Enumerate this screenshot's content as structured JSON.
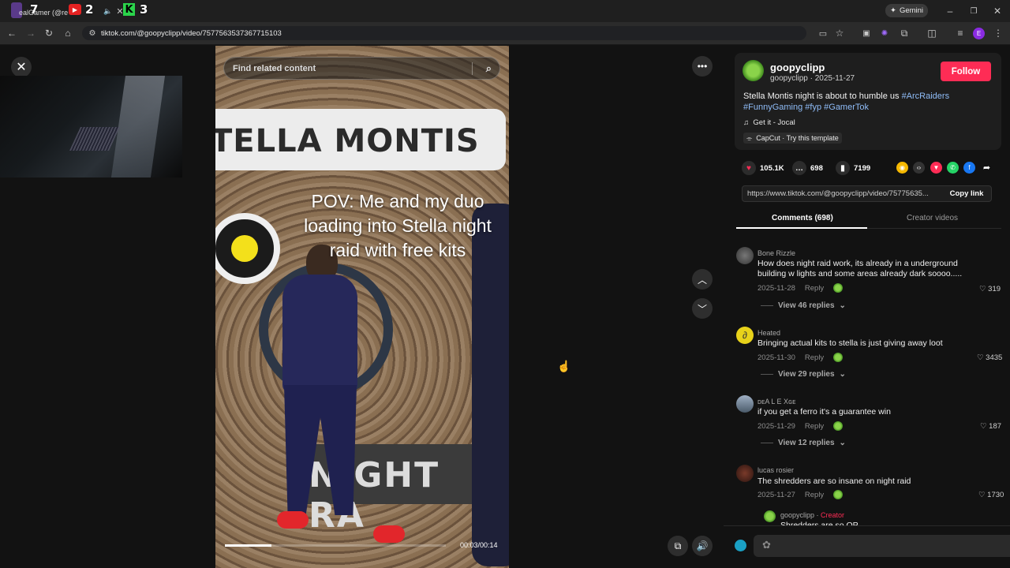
{
  "browser": {
    "overlay_counts": [
      "7",
      "2",
      "3"
    ],
    "tab_title": "ealGamer (@re",
    "gemini_label": "Gemini",
    "url": "tiktok.com/@goopyclipp/video/7577563537367715103"
  },
  "video": {
    "search_placeholder": "Find related content",
    "top_sign": "TELLA MONTIS",
    "bottom_sign": "NIGHT RA",
    "caption": "POV: Me and my duo loading into Stella night raid with free kits",
    "time": "00:03/00:14",
    "progress": 0.21
  },
  "author": {
    "username": "goopyclipp",
    "handle_line": "goopyclipp · 2025-11-27",
    "follow_label": "Follow",
    "description_text": "Stella Montis night is about to humble us ",
    "hashtags": [
      "#ArcRaiders",
      "#FunnyGaming",
      "#fyp",
      "#GamerTok"
    ],
    "music": "Get it - Jocal",
    "template": "CapCut · Try this template"
  },
  "stats": {
    "likes": "105.1K",
    "comments": "698",
    "saves": "7199"
  },
  "link": {
    "url": "https://www.tiktok.com/@goopyclipp/video/75775635...",
    "copy_label": "Copy link"
  },
  "tabs": {
    "comments": "Comments (698)",
    "creator": "Creator videos"
  },
  "comments": [
    {
      "name": "Bone Rizzle",
      "text": "How does night raid work, its already in a underground building w lights and some areas already dark soooo.....",
      "date": "2025-11-28",
      "reply": "Reply",
      "likes": "319",
      "replies": "View 46 replies"
    },
    {
      "name": "Heated",
      "text": "Bringing actual kits to stella is just giving away loot",
      "date": "2025-11-30",
      "reply": "Reply",
      "likes": "3435",
      "replies": "View 29 replies"
    },
    {
      "name": "ᴅᴇA L E Xɢᴇ",
      "text": "if you get a ferro it's a guarantee win",
      "date": "2025-11-29",
      "reply": "Reply",
      "likes": "187",
      "replies": "View 12 replies"
    },
    {
      "name": "lucas rosier",
      "text": "The shredders are so insane on night raid",
      "date": "2025-11-27",
      "reply": "Reply",
      "likes": "1730",
      "replies": ""
    }
  ],
  "creator_reply": {
    "name": "goopyclipp",
    "badge": "Creator",
    "text": "Shredders are so OP"
  },
  "icons": [
    "close-icon",
    "search-icon",
    "more-icon",
    "chevron-up-icon",
    "chevron-down-icon",
    "volume-icon",
    "heart-icon",
    "comment-icon",
    "bookmark-icon",
    "music-icon"
  ],
  "colors": {
    "follow": "#fe2c55",
    "hashtag": "#8fbcf7",
    "accent_like": "#fe2c55"
  }
}
